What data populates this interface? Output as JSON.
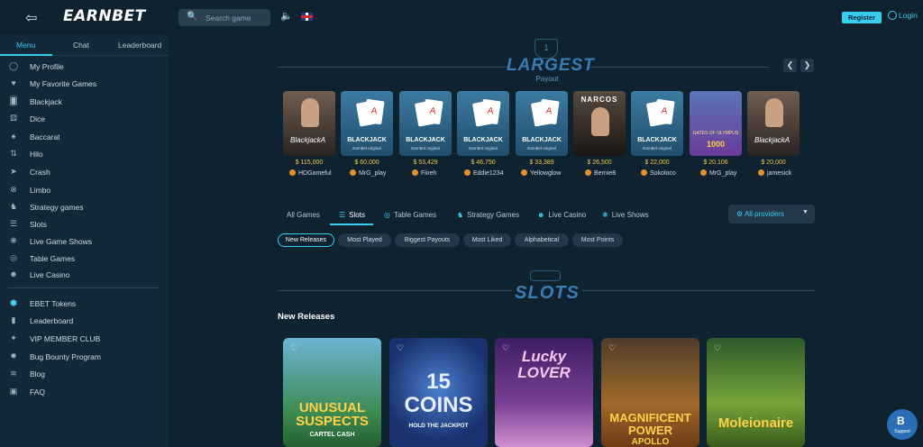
{
  "header": {
    "logo": "EARNBET",
    "search_placeholder": "Search game",
    "register": "Register",
    "login": "Login"
  },
  "sidebar": {
    "tabs": [
      "Menu",
      "Chat",
      "Leaderboard"
    ],
    "items": [
      {
        "label": "My Profile",
        "icon": "user-circle-icon"
      },
      {
        "label": "My Favorite Games",
        "icon": "heart-icon"
      },
      {
        "label": "Blackjack",
        "icon": "cards-icon"
      },
      {
        "label": "Dice",
        "icon": "dice-icon"
      },
      {
        "label": "Baccarat",
        "icon": "baccarat-icon"
      },
      {
        "label": "Hilo",
        "icon": "hilo-icon"
      },
      {
        "label": "Crash",
        "icon": "rocket-icon"
      },
      {
        "label": "Limbo",
        "icon": "limbo-icon"
      },
      {
        "label": "Strategy games",
        "icon": "chess-icon"
      },
      {
        "label": "Slots",
        "icon": "slots-icon"
      },
      {
        "label": "Live Game Shows",
        "icon": "wheel-icon"
      },
      {
        "label": "Table Games",
        "icon": "chip-icon"
      },
      {
        "label": "Live Casino",
        "icon": "dealer-icon"
      }
    ],
    "items2": [
      {
        "label": "EBET Tokens",
        "icon": "token-icon"
      },
      {
        "label": "Leaderboard",
        "icon": "bar-chart-icon"
      },
      {
        "label": "VIP MEMBER CLUB",
        "icon": "sparkle-icon"
      },
      {
        "label": "Bug Bounty Program",
        "icon": "bug-icon"
      },
      {
        "label": "Blog",
        "icon": "rss-icon"
      },
      {
        "label": "FAQ",
        "icon": "faq-icon"
      }
    ]
  },
  "largest_payout": {
    "trophy_rank": "1",
    "title": "LARGEST",
    "subtitle": "Payout",
    "cards": [
      {
        "type": "live",
        "title": "BlackjackA",
        "subtitle": "",
        "amount": "$ 115,000",
        "user": "HDGameful"
      },
      {
        "type": "bj",
        "title": "BLACKJACK",
        "subtitle": "Earnbet original",
        "amount": "$ 60,000",
        "user": "MrG_play"
      },
      {
        "type": "bj",
        "title": "BLACKJACK",
        "subtitle": "Earnbet original",
        "amount": "$ 53,429",
        "user": "Fiireh"
      },
      {
        "type": "bj",
        "title": "BLACKJACK",
        "subtitle": "Earnbet original",
        "amount": "$ 46,750",
        "user": "Eddie1234"
      },
      {
        "type": "bj",
        "title": "BLACKJACK",
        "subtitle": "Earnbet original",
        "amount": "$ 33,389",
        "user": "Yellowglow"
      },
      {
        "type": "narcos",
        "title": "NARCOS",
        "subtitle": "",
        "amount": "$ 26,500",
        "user": "Bernie8"
      },
      {
        "type": "bj",
        "title": "BLACKJACK",
        "subtitle": "Earnbet original",
        "amount": "$ 22,000",
        "user": "Sokoloco"
      },
      {
        "type": "gates",
        "title": "1000",
        "subtitle": "GATES OF OLYMPUS",
        "amount": "$ 20,106",
        "user": "MrG_play"
      },
      {
        "type": "live",
        "title": "BlackjackA",
        "subtitle": "",
        "amount": "$ 20,000",
        "user": "jamesick"
      }
    ]
  },
  "category_tabs": [
    {
      "label": "All Games",
      "icon": ""
    },
    {
      "label": "Slots",
      "icon": "slots-icon",
      "active": true
    },
    {
      "label": "Table Games",
      "icon": "chip-icon"
    },
    {
      "label": "Strategy Games",
      "icon": "chess-icon"
    },
    {
      "label": "Live Casino",
      "icon": "dealer-icon"
    },
    {
      "label": "Live Shows",
      "icon": "wheel-icon"
    }
  ],
  "providers_label": "All providers",
  "filters": [
    "New Releases",
    "Most Played",
    "Biggest Payouts",
    "Most Liked",
    "Alphabetical",
    "Most Points"
  ],
  "slots_section": {
    "title": "SLOTS",
    "subtitle": "New Releases",
    "games": [
      {
        "title": "UNUSUAL SUSPECTS",
        "subtitle": "CARTEL CASH"
      },
      {
        "title": "15 COINS",
        "subtitle": "HOLD THE JACKPOT"
      },
      {
        "title": "Lucky LOVER",
        "subtitle": ""
      },
      {
        "title": "MAGNIFICENT POWER",
        "subtitle": "APOLLO"
      },
      {
        "title": "Moleionaire",
        "subtitle": ""
      }
    ]
  },
  "support_label": "Support"
}
